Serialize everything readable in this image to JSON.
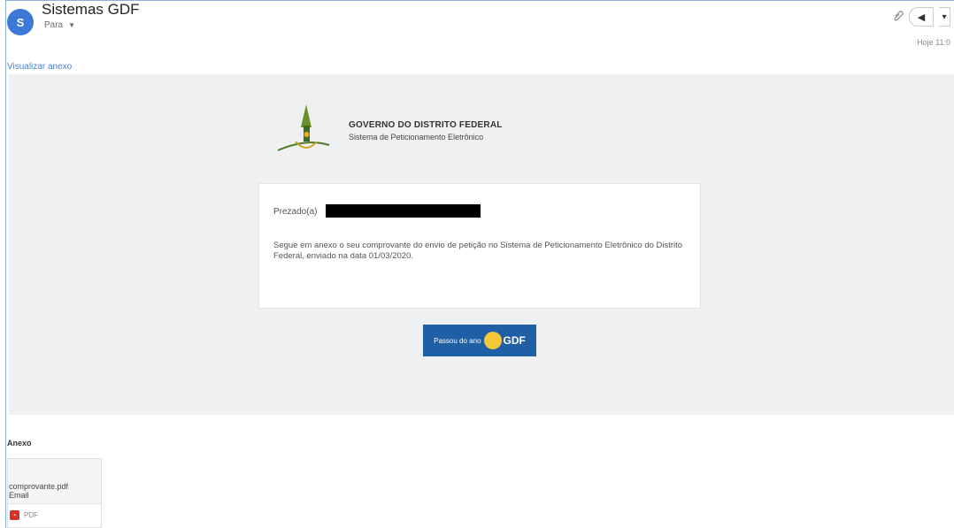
{
  "header": {
    "avatar_letter": "S",
    "sender": "Sistemas GDF",
    "recipient": "Para",
    "date": "Hoje 11:0",
    "icons": [
      "paperclip-icon",
      "reply-icon",
      "more-options-icon"
    ]
  },
  "view_attachment_link": "Visualizar anexo",
  "email": {
    "org_title": "GOVERNO DO DISTRITO FEDERAL",
    "org_subtitle": "Sistema de Peticionamento Eletrônico",
    "greeting": "Prezado(a)",
    "message": "Segue em anexo o seu comprovante do envio de petição no Sistema de Peticionamento Eletrônico do Distrito Federal, enviado na data 01/03/2020.",
    "banner_text": "Passou do ano",
    "banner_brand": "GDF",
    "colors": {
      "banner": "#1f5fa6",
      "sun": "#f4c63a",
      "body_bg": "#eff0f2"
    }
  },
  "attachments": {
    "title": "Anexo",
    "items": [
      {
        "name": "comprovante.pdf",
        "sub": "Email",
        "type": "PDF"
      }
    ]
  }
}
